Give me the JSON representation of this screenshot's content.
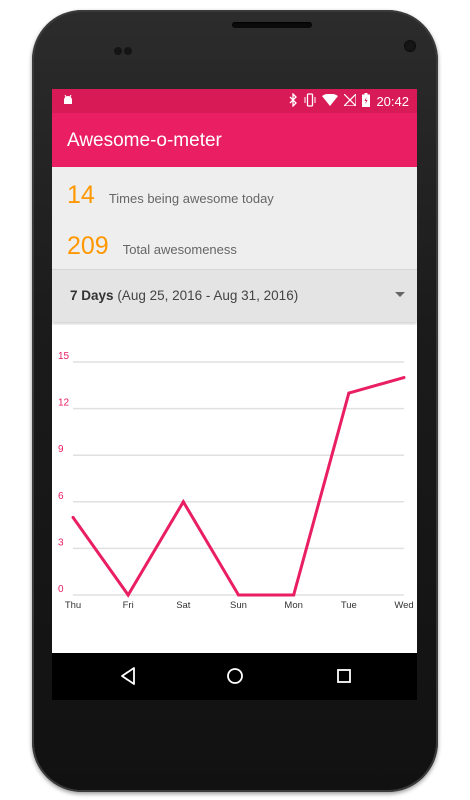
{
  "status_bar": {
    "time": "20:42",
    "icons": [
      "android-debug-icon",
      "bluetooth-icon",
      "vibrate-icon",
      "wifi-icon",
      "no-sim-icon",
      "battery-icon"
    ]
  },
  "app_bar": {
    "title": "Awesome-o-meter"
  },
  "summary": {
    "today_count": "14",
    "today_label": "Times being awesome today",
    "total_count": "209",
    "total_label": "Total awesomeness"
  },
  "range_selector": {
    "selected": "7 Days",
    "range": "(Aug 25, 2016 - Aug 31, 2016)"
  },
  "colors": {
    "accent": "#e91e63",
    "status_bar": "#d81b57",
    "number": "#ff9800",
    "grid": "#e0e0e0",
    "tick_label": "#e91e63"
  },
  "chart_data": {
    "type": "line",
    "categories": [
      "Thu",
      "Fri",
      "Sat",
      "Sun",
      "Mon",
      "Tue",
      "Wed"
    ],
    "values": [
      5,
      0,
      6,
      0,
      0,
      13,
      14
    ],
    "y_ticks": [
      0,
      3,
      6,
      9,
      12,
      15
    ],
    "ylim": [
      0,
      15
    ],
    "grid": true,
    "legend": "none"
  },
  "nav_bar": {
    "buttons": [
      "back-icon",
      "home-icon",
      "recent-apps-icon"
    ]
  }
}
